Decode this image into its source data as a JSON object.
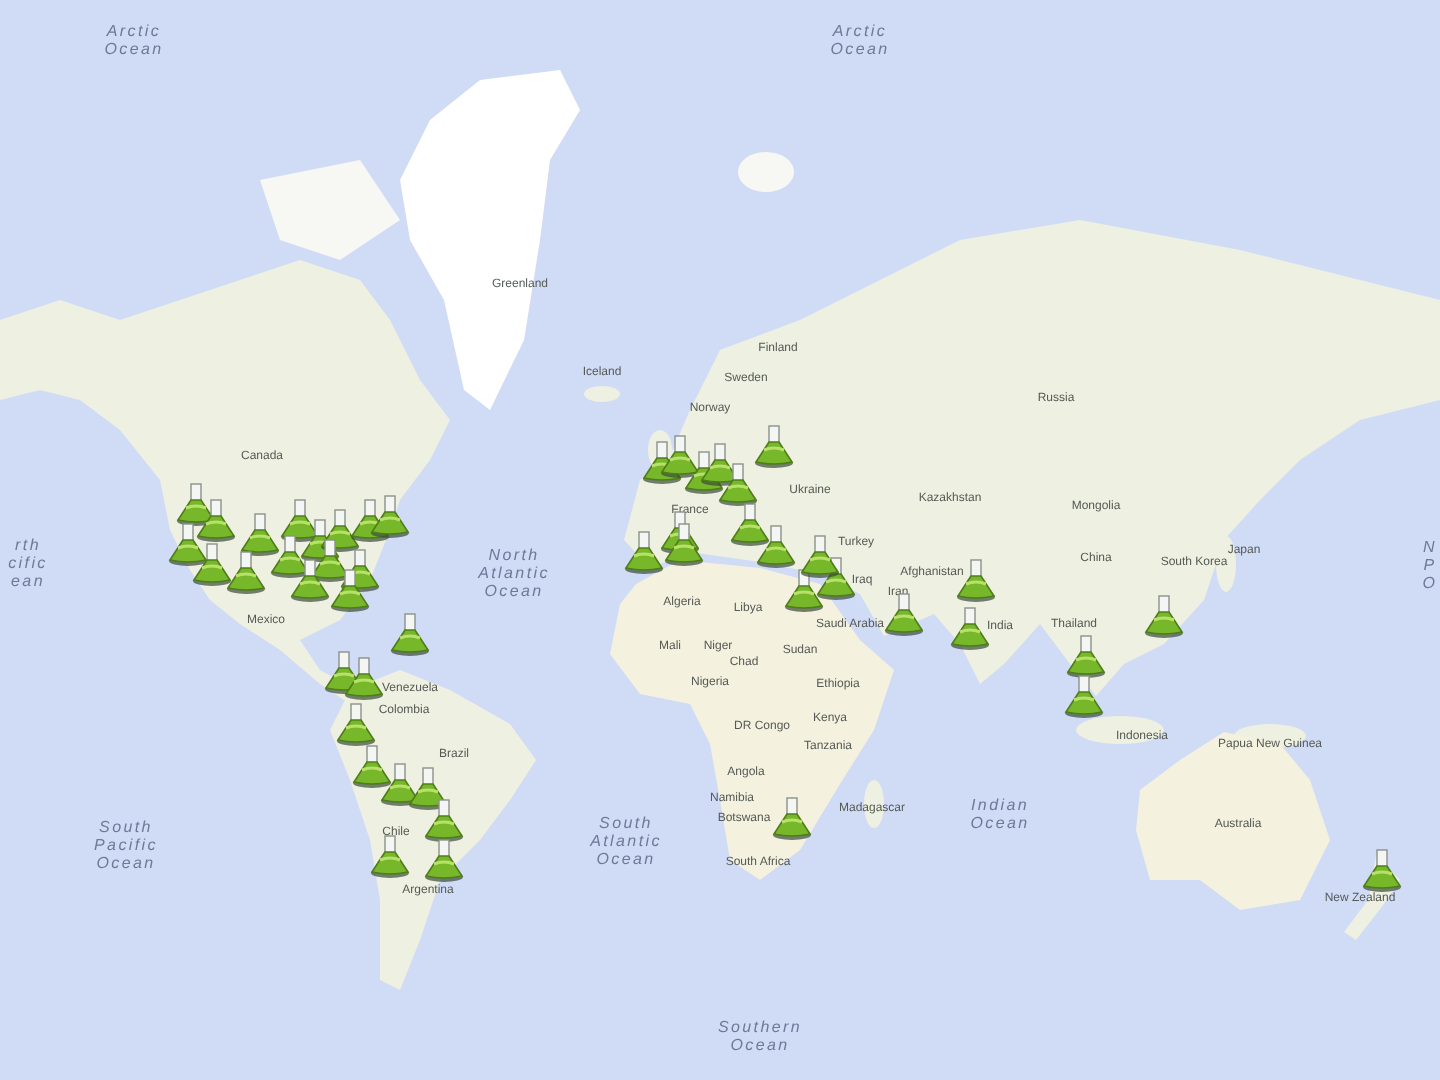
{
  "map": {
    "labels": [
      {
        "kind": "ocean",
        "text": "Arctic Ocean"
      },
      {
        "kind": "ocean",
        "text": "Arctic Ocean"
      },
      {
        "kind": "country",
        "text": "Greenland"
      },
      {
        "kind": "country",
        "text": "Iceland"
      },
      {
        "kind": "country",
        "text": "Finland"
      },
      {
        "kind": "country",
        "text": "Sweden"
      },
      {
        "kind": "country",
        "text": "Norway"
      },
      {
        "kind": "country",
        "text": "Russia"
      },
      {
        "kind": "country",
        "text": "Canada"
      },
      {
        "kind": "ocean",
        "text": "rth cific ean"
      },
      {
        "kind": "ocean",
        "text": "North Atlantic Ocean"
      },
      {
        "kind": "country",
        "text": "Ukraine"
      },
      {
        "kind": "country",
        "text": "France"
      },
      {
        "kind": "country",
        "text": "Kazakhstan"
      },
      {
        "kind": "country",
        "text": "Mongolia"
      },
      {
        "kind": "country",
        "text": "Turkey"
      },
      {
        "kind": "country",
        "text": "Japan"
      },
      {
        "kind": "country",
        "text": "China"
      },
      {
        "kind": "country",
        "text": "South Korea"
      },
      {
        "kind": "country",
        "text": "Iraq"
      },
      {
        "kind": "country",
        "text": "Afghanistan"
      },
      {
        "kind": "country",
        "text": "Iran"
      },
      {
        "kind": "ocean",
        "text": "N P O"
      },
      {
        "kind": "country",
        "text": "Algeria"
      },
      {
        "kind": "country",
        "text": "Libya"
      },
      {
        "kind": "country",
        "text": "Mexico"
      },
      {
        "kind": "country",
        "text": "Saudi Arabia"
      },
      {
        "kind": "country",
        "text": "India"
      },
      {
        "kind": "country",
        "text": "Thailand"
      },
      {
        "kind": "country",
        "text": "Mali"
      },
      {
        "kind": "country",
        "text": "Niger"
      },
      {
        "kind": "country",
        "text": "Sudan"
      },
      {
        "kind": "country",
        "text": "Chad"
      },
      {
        "kind": "country",
        "text": "Venezuela"
      },
      {
        "kind": "country",
        "text": "Nigeria"
      },
      {
        "kind": "country",
        "text": "Ethiopia"
      },
      {
        "kind": "country",
        "text": "Colombia"
      },
      {
        "kind": "country",
        "text": "Kenya"
      },
      {
        "kind": "country",
        "text": "DR Congo"
      },
      {
        "kind": "country",
        "text": "Tanzania"
      },
      {
        "kind": "country",
        "text": "Indonesia"
      },
      {
        "kind": "country",
        "text": "Papua New Guinea"
      },
      {
        "kind": "country",
        "text": "Brazil"
      },
      {
        "kind": "country",
        "text": "Angola"
      },
      {
        "kind": "country",
        "text": "Namibia"
      },
      {
        "kind": "country",
        "text": "Botswana"
      },
      {
        "kind": "country",
        "text": "Madagascar"
      },
      {
        "kind": "ocean",
        "text": "Indian Ocean"
      },
      {
        "kind": "ocean",
        "text": "South Pacific Ocean"
      },
      {
        "kind": "country",
        "text": "Chile"
      },
      {
        "kind": "ocean",
        "text": "South Atlantic Ocean"
      },
      {
        "kind": "country",
        "text": "Australia"
      },
      {
        "kind": "country",
        "text": "South Africa"
      },
      {
        "kind": "country",
        "text": "Argentina"
      },
      {
        "kind": "country",
        "text": "New Zealand"
      },
      {
        "kind": "ocean",
        "text": "Southern Ocean"
      }
    ]
  }
}
